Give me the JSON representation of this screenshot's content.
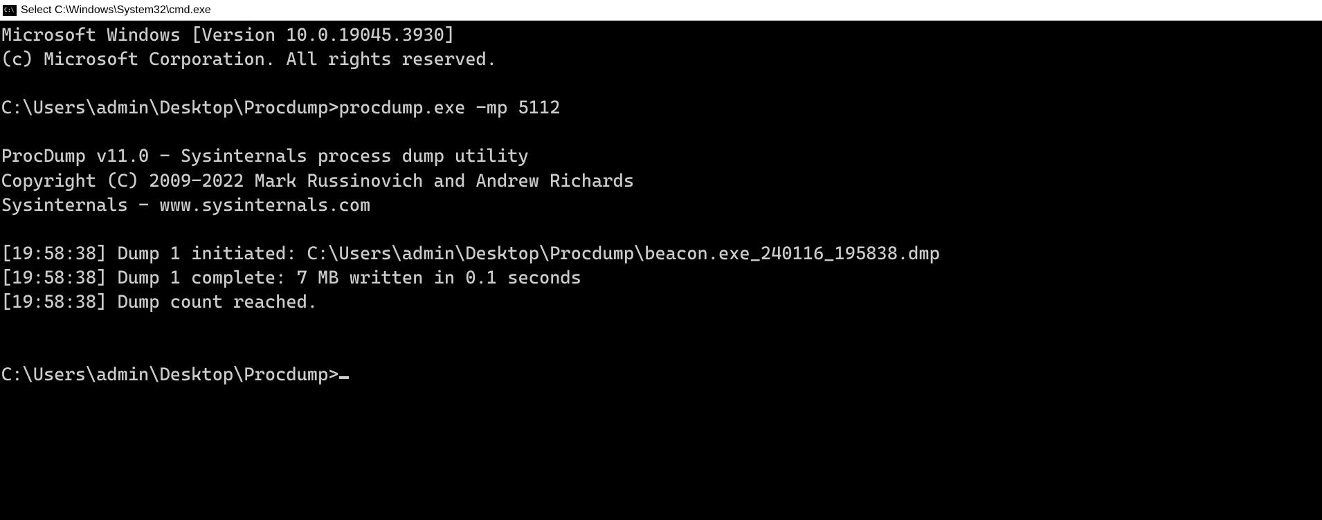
{
  "titlebar": {
    "text": "Select C:\\Windows\\System32\\cmd.exe"
  },
  "terminal": {
    "line1": "Microsoft Windows [Version 10.0.19045.3930]",
    "line2": "(c) Microsoft Corporation. All rights reserved.",
    "blank1": "",
    "prompt1": "C:\\Users\\admin\\Desktop\\Procdump>procdump.exe -mp 5112",
    "blank2": "",
    "line3": "ProcDump v11.0 - Sysinternals process dump utility",
    "line4": "Copyright (C) 2009-2022 Mark Russinovich and Andrew Richards",
    "line5": "Sysinternals - www.sysinternals.com",
    "blank3": "",
    "line6": "[19:58:38] Dump 1 initiated: C:\\Users\\admin\\Desktop\\Procdump\\beacon.exe_240116_195838.dmp",
    "line7": "[19:58:38] Dump 1 complete: 7 MB written in 0.1 seconds",
    "line8": "[19:58:38] Dump count reached.",
    "blank4": "",
    "blank5": "",
    "prompt2": "C:\\Users\\admin\\Desktop\\Procdump>"
  }
}
